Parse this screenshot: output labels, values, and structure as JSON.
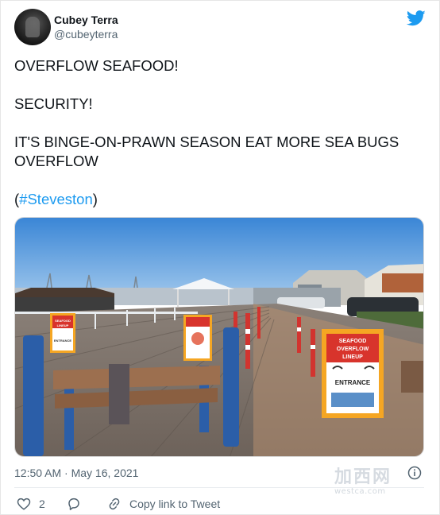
{
  "author": {
    "display_name": "Cubey Terra",
    "handle": "@cubeyterra",
    "avatar_icon": "avatar-image"
  },
  "brand_icon": "twitter-bird-icon",
  "brand_color": "#1d9bf0",
  "tweet": {
    "line1": "OVERFLOW SEAFOOD!",
    "line2": "SECURITY!",
    "line3": "IT'S BINGE-ON-PRAWN SEASON EAT MORE SEA BUGS OVERFLOW",
    "hashtag_open": "(",
    "hashtag": "#Steveston",
    "hashtag_close": ")"
  },
  "photo": {
    "sign_left": {
      "line1": "SEAFOOD",
      "line2": "LINEUP",
      "line3": "ENTRANCE"
    },
    "sign_right": {
      "line1": "SEAFOOD",
      "line2": "OVERFLOW",
      "line3": "LINEUP",
      "line4": "ENTRANCE"
    }
  },
  "meta": {
    "timestamp": "12:50 AM · May 16, 2021"
  },
  "actions": {
    "like_count": "2",
    "copy_link_label": "Copy link to Tweet"
  },
  "watermark": {
    "cn": "加西网",
    "url": "westca.com"
  }
}
